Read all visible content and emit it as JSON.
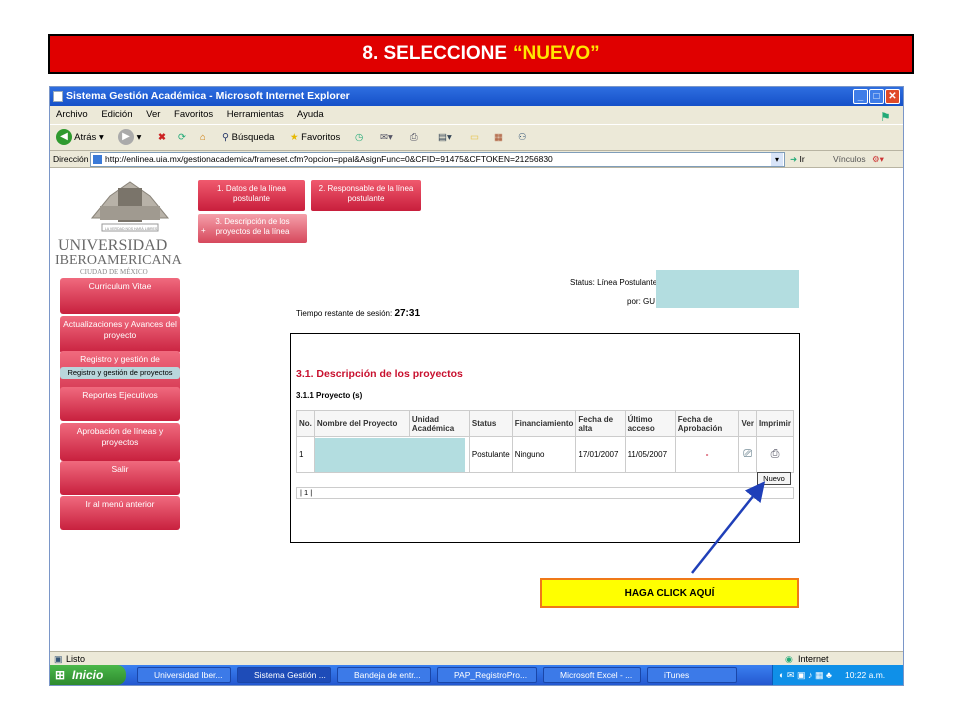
{
  "slide": {
    "title_prefix": "8. SELECCIONE ",
    "title_highlight": "“NUEVO”",
    "callout": "HAGA CLICK AQUÍ"
  },
  "window": {
    "title": "Sistema Gestión Académica - Microsoft Internet Explorer"
  },
  "menu": [
    "Archivo",
    "Edición",
    "Ver",
    "Favoritos",
    "Herramientas",
    "Ayuda"
  ],
  "toolbar": {
    "back": "Atrás",
    "search": "Búsqueda",
    "favorites": "Favoritos"
  },
  "address": {
    "label": "Dirección",
    "url": "http://enlinea.uia.mx/gestionacademica/frameset.cfm?opcion=ppal&AsignFunc=0&CFID=91475&CFTOKEN=21256830",
    "go": "Ir",
    "links": "Vínculos"
  },
  "logo": {
    "motto": "LA VERDAD NOS HARÁ LIBRES",
    "line1": "UNIVERSIDAD",
    "line2": "IBEROAMERICANA",
    "line3": "CIUDAD DE MÉXICO"
  },
  "tabs": [
    "1. Datos de la línea postulante",
    "2. Responsable de la línea postulante",
    "3. Descripción de los proyectos de la línea"
  ],
  "tab_marker": "+",
  "sidebar": [
    "Curriculum Vitae",
    "Actualizaciones y Avances del proyecto",
    "Registro y gestión de",
    "Registro y gestión de proyectos",
    "Reportes Ejecutivos",
    "Aprobación de líneas y proyectos",
    "Salir",
    "Ir al menú anterior"
  ],
  "status": {
    "label": "Status: Línea Postulante",
    "por": "por: GU"
  },
  "session": {
    "label": "Tiempo restante de sesión:",
    "time": "27:31"
  },
  "section": {
    "title": "3.1. Descripción de los proyectos",
    "subtitle": "3.1.1 Proyecto (s)"
  },
  "table": {
    "headers": [
      "No.",
      "Nombre del Proyecto",
      "Unidad Académica",
      "Status",
      "Financiamiento",
      "Fecha de alta",
      "Último acceso",
      "Fecha de Aprobación",
      "Ver",
      "Imprimir"
    ],
    "rows": [
      {
        "no": "1",
        "status": "Postulante",
        "financiamiento": "Ninguno",
        "alta": "17/01/2007",
        "acceso": "11/05/2007",
        "aprobacion": "-"
      }
    ]
  },
  "nuevo_button": "Nuevo",
  "pager": "|  1  |",
  "statusbar": {
    "left": "Listo",
    "right": "Internet"
  },
  "taskbar": {
    "start": "Inicio",
    "items": [
      "Universidad Iber...",
      "Sistema Gestión ...",
      "Bandeja de entr...",
      "PAP_RegistroPro...",
      "Microsoft Excel - ...",
      "iTunes"
    ],
    "clock": "10:22 a.m."
  },
  "colors": {
    "slide_red": "#e00000",
    "highlight": "#ffe600",
    "callout_yellow": "#ffff00",
    "callout_border": "#f07818",
    "nav_pink": "#d8334e",
    "section_red": "#c8102e",
    "redaction": "#b3dde0",
    "arrow": "#1f3fb8"
  }
}
